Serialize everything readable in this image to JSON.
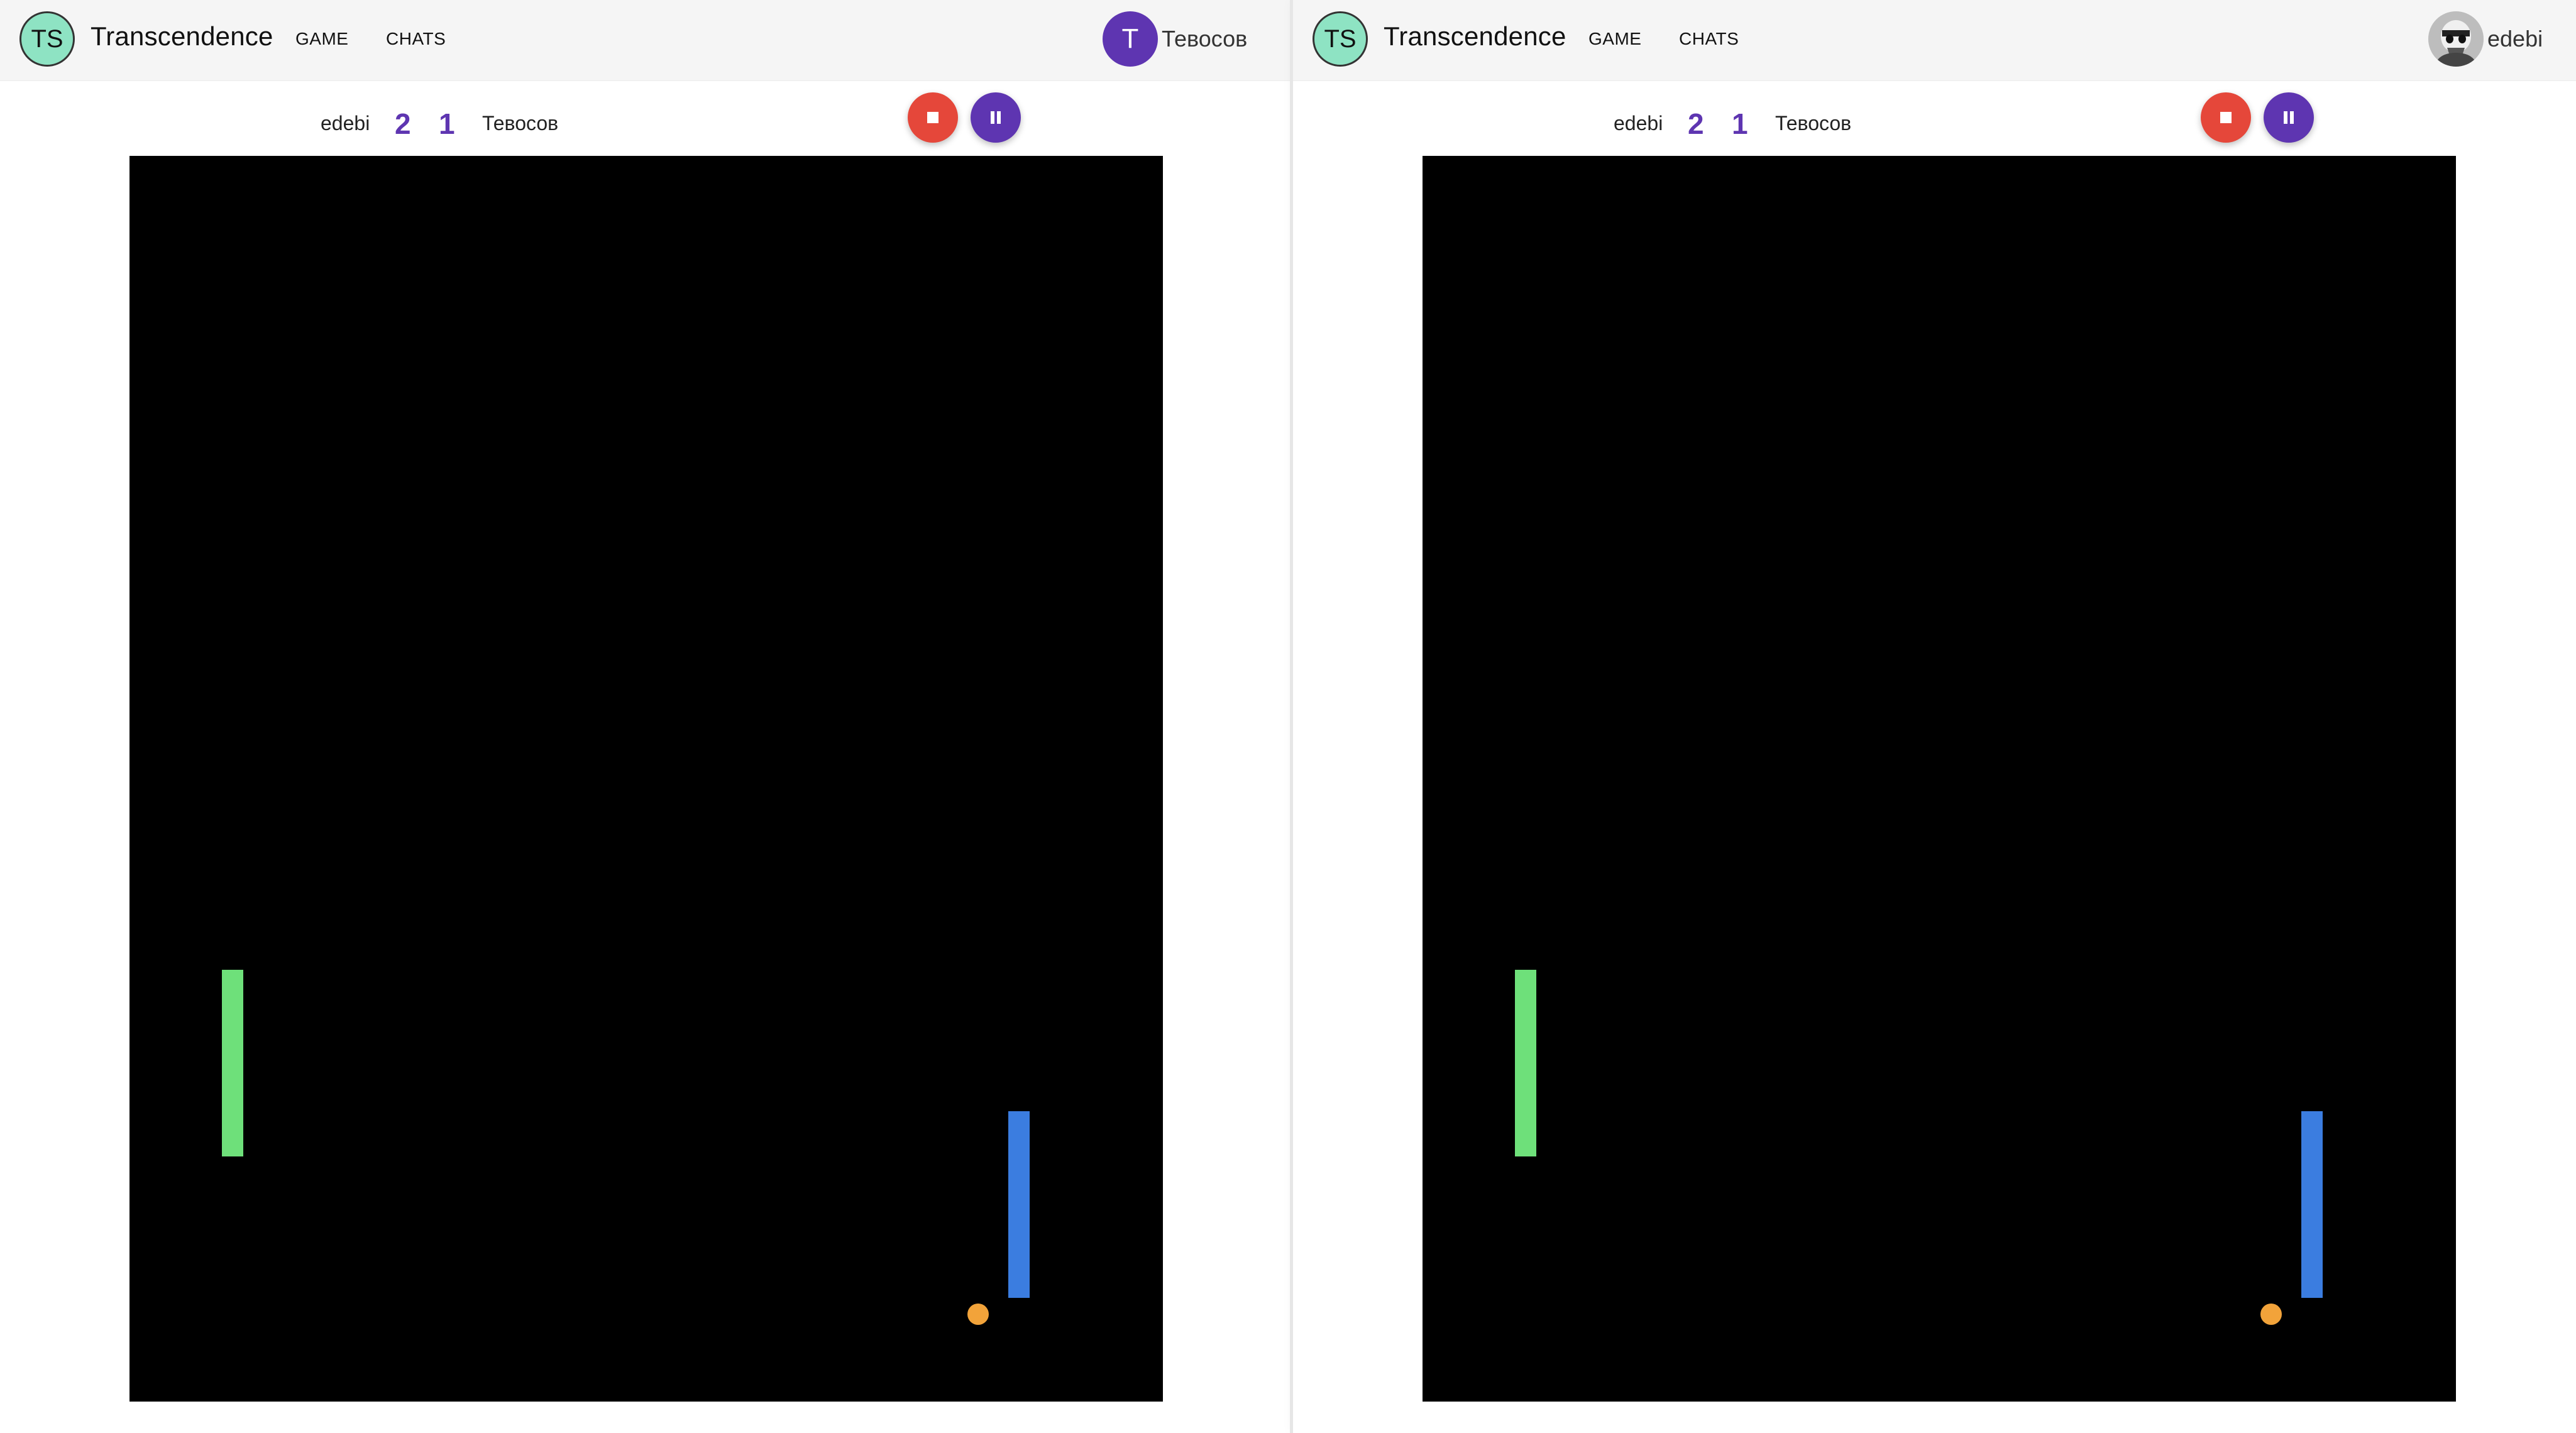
{
  "app": {
    "logo_text": "TS",
    "brand": "Transcendence",
    "nav": {
      "game": "GAME",
      "chats": "CHATS"
    }
  },
  "left_pane": {
    "user": {
      "avatar_letter": "T",
      "name": "Тевосов"
    },
    "scoreboard": {
      "player1": "edebi",
      "score1": "2",
      "score2": "1",
      "player2": "Тевосов"
    },
    "icons": {
      "stop": "stop-icon",
      "pause": "pause-icon"
    }
  },
  "right_pane": {
    "user": {
      "avatar": "user-photo",
      "name": "edebi"
    },
    "scoreboard": {
      "player1": "edebi",
      "score1": "2",
      "score2": "1",
      "player2": "Тевосов"
    },
    "icons": {
      "stop": "stop-icon",
      "pause": "pause-icon"
    }
  },
  "colors": {
    "logo_bg": "#8ee3c3",
    "accent": "#5e35b1",
    "stop_button": "#e5473a",
    "court": "#000000",
    "left_paddle": "#6ee07a",
    "right_paddle": "#3b7de0",
    "ball": "#f2a33a"
  }
}
